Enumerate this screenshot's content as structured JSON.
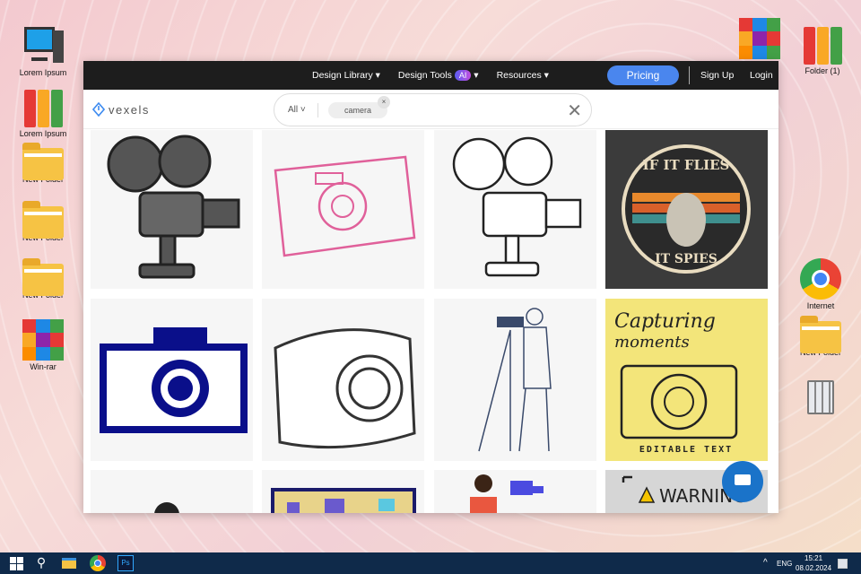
{
  "desktop": {
    "left": [
      {
        "label": "Lorem Ipsum",
        "icon": "computer"
      },
      {
        "label": "Lorem Ipsum",
        "icon": "binders"
      },
      {
        "label": "New Folder",
        "icon": "folder"
      },
      {
        "label": "New Folder",
        "icon": "folder"
      },
      {
        "label": "New Folder",
        "icon": "folder"
      },
      {
        "label": "Win-rar",
        "icon": "winrar"
      }
    ],
    "right": [
      {
        "label": "Folder (1)",
        "icon": "binders"
      },
      {
        "label": "Internet",
        "icon": "chrome"
      },
      {
        "label": "New Folder",
        "icon": "folder"
      }
    ]
  },
  "browser": {
    "nav": {
      "design_library": "Design Library",
      "design_tools": "Design Tools",
      "ai_badge": "AI",
      "resources": "Resources",
      "pricing": "Pricing",
      "signup": "Sign Up",
      "login": "Login"
    },
    "logo": "vexels",
    "search": {
      "scope": "All",
      "chip": "camera",
      "chip_remove": "×",
      "clear": "✕"
    },
    "cards": {
      "c4_top": "IF IT FLIES",
      "c4_bottom": "IT SPIES",
      "c8_title1": "Capturing",
      "c8_title2": "moments",
      "c8_footer": "EDITABLE TEXT",
      "c12": "WARNING"
    }
  },
  "taskbar": {
    "lang": "ENG",
    "time": "15:21",
    "date": "08.02.2024",
    "tray_up": "^"
  }
}
